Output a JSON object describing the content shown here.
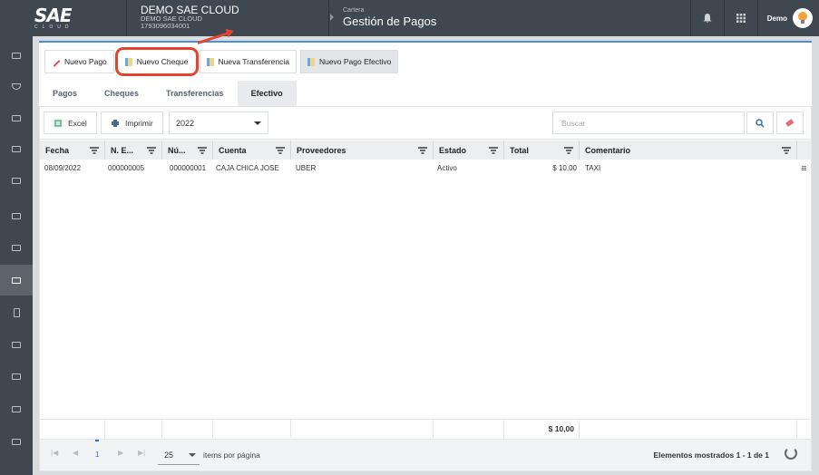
{
  "header": {
    "logo_main": "SAE",
    "logo_sub": "CLOUD",
    "company_name": "DEMO SAE CLOUD",
    "company_sub": "DEMO SAE CLOUD",
    "company_ruc": "1793096034001",
    "module_section": "Cartera",
    "module_title": "Gestión de Pagos",
    "user_name": "Demo"
  },
  "actions": {
    "nuevo_pago": "Nuevo Pago",
    "nuevo_cheque": "Nuevo Cheque",
    "nueva_transferencia": "Nueva Transferencia",
    "nuevo_pago_efectivo": "Nuevo Pago Efectivo"
  },
  "tabs": [
    {
      "label": "Pagos"
    },
    {
      "label": "Cheques"
    },
    {
      "label": "Transferencias"
    },
    {
      "label": "Efectivo"
    }
  ],
  "toolbar": {
    "excel": "Excel",
    "imprimir": "Imprimir",
    "year": "2022",
    "search_placeholder": "Buscar"
  },
  "columns": [
    "Fecha",
    "N. E...",
    "Nú...",
    "Cuenta",
    "Proveedores",
    "Estado",
    "Total",
    "Comentario"
  ],
  "rows": [
    {
      "fecha": "08/09/2022",
      "ne": "000000005",
      "nu": "000000001",
      "cuenta": "CAJA CHICA JOSE",
      "proveedor": "UBER",
      "estado": "Activo",
      "total": "$ 10,00",
      "comentario": "TAXI"
    }
  ],
  "summary": {
    "total": "$ 10,00"
  },
  "pager": {
    "current_page": "1",
    "page_size": "25",
    "page_size_label": "items por página",
    "shown_label": "Elementos mostrados 1 - 1 de 1"
  },
  "colors": {
    "accent": "#4a90d9",
    "highlight": "#e2452e",
    "topbar": "#3f4750"
  }
}
